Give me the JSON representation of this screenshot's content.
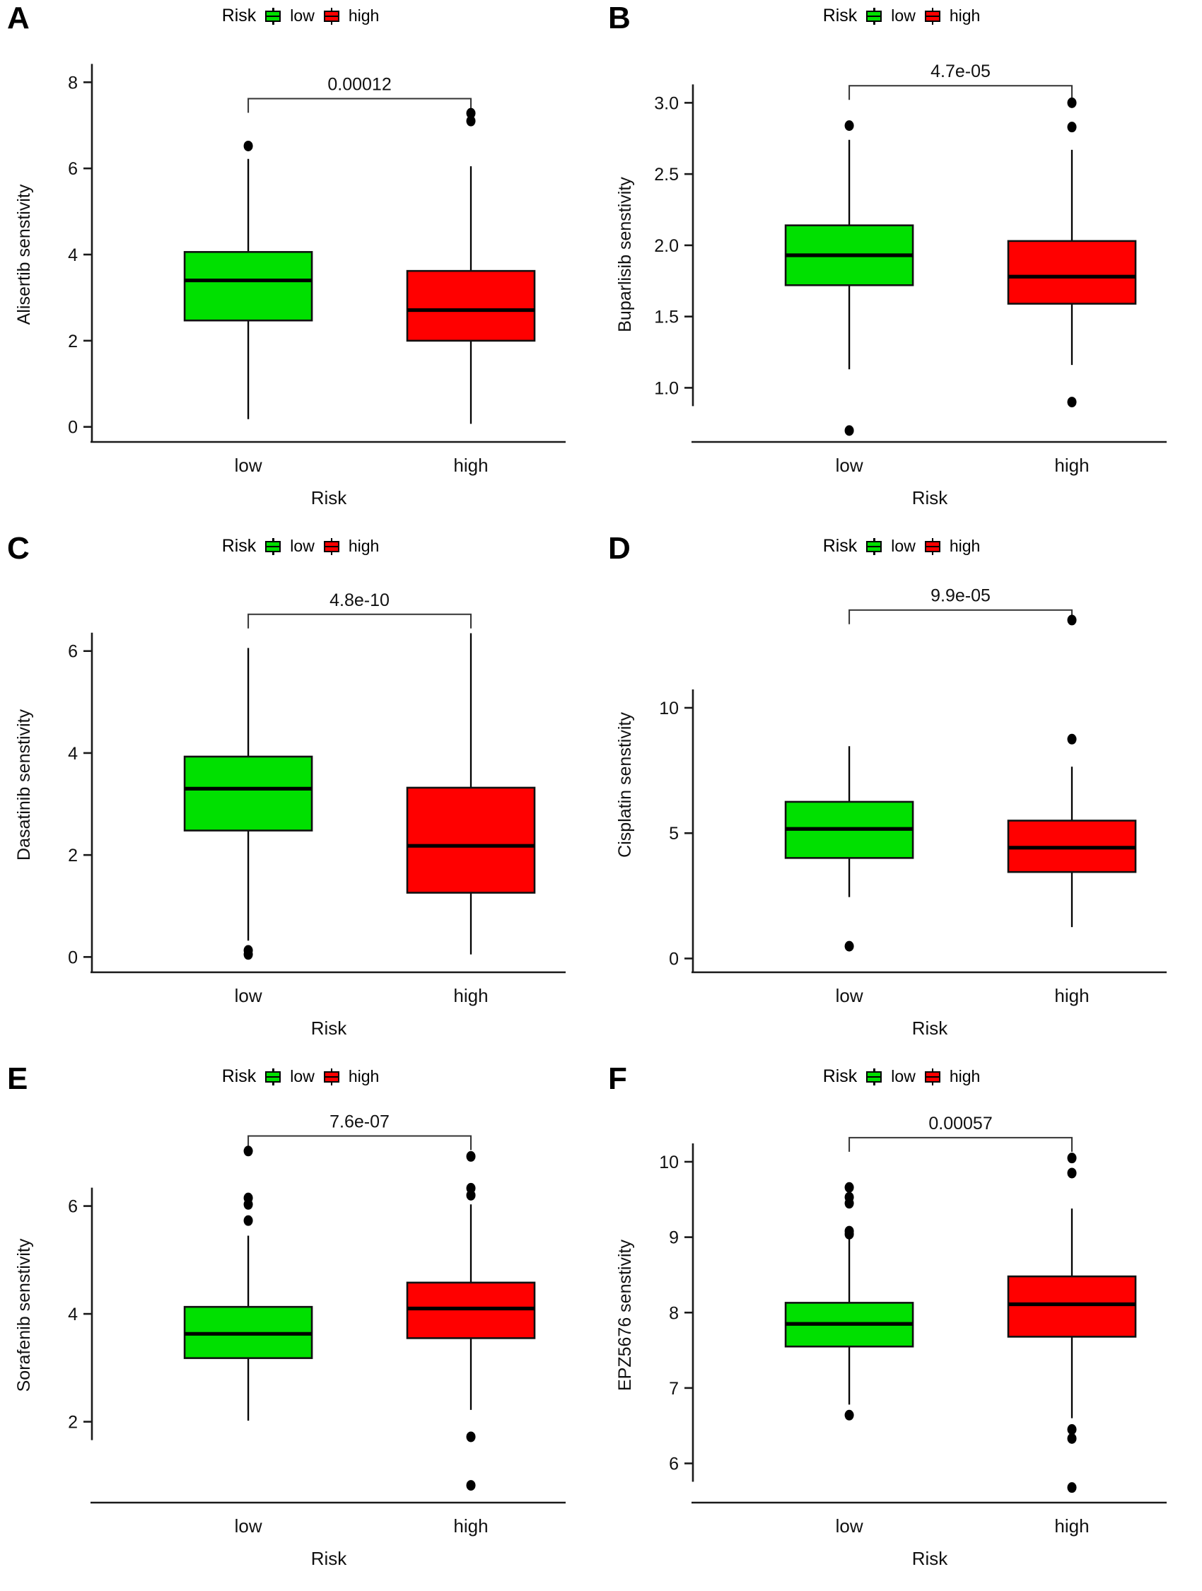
{
  "figure": {
    "legend": {
      "title": "Risk",
      "low_label": "low",
      "high_label": "high"
    },
    "colors": {
      "low": "#00E000",
      "high": "#FF0000",
      "outline": "#111111",
      "text": "#111111"
    },
    "x_axis_title": "Risk",
    "categories": [
      "low",
      "high"
    ]
  },
  "panels": [
    {
      "letter": "A",
      "ylabel": "Alisertib senstivity",
      "pvalue": "0.00012",
      "ylim": [
        -0.35,
        8.35
      ],
      "yticks": [
        0,
        2,
        4,
        6,
        8
      ],
      "ytick_labels": [
        "0",
        "2",
        "4",
        "6",
        "8"
      ],
      "bracket_y": 7.62,
      "chart_data": {
        "type": "box",
        "title": "",
        "xlabel": "Risk",
        "ylabel": "Alisertib senstivity",
        "categories": [
          "low",
          "high"
        ],
        "boxes": [
          {
            "group": "low",
            "color": "#00E000",
            "min": 0.18,
            "q1": 2.47,
            "median": 3.4,
            "q3": 4.06,
            "max": 6.22,
            "outliers": [
              6.52
            ]
          },
          {
            "group": "high",
            "color": "#FF0000",
            "min": 0.07,
            "q1": 2.0,
            "median": 2.71,
            "q3": 3.62,
            "max": 6.05,
            "outliers": [
              7.28,
              7.1
            ]
          }
        ],
        "annotations": [
          {
            "text": "0.00012",
            "type": "p-value",
            "between": [
              "low",
              "high"
            ]
          }
        ]
      }
    },
    {
      "letter": "B",
      "ylabel": "Buparlisib senstivity",
      "pvalue": "4.7e-05",
      "ylim": [
        0.62,
        3.25
      ],
      "yticks": [
        1.0,
        1.5,
        2.0,
        2.5,
        3.0
      ],
      "ytick_labels": [
        "1.0",
        "1.5",
        "2.0",
        "2.5",
        "3.0"
      ],
      "bracket_y": 3.12,
      "chart_data": {
        "type": "box",
        "title": "",
        "xlabel": "Risk",
        "ylabel": "Buparlisib senstivity",
        "categories": [
          "low",
          "high"
        ],
        "boxes": [
          {
            "group": "low",
            "color": "#00E000",
            "min": 1.13,
            "q1": 1.72,
            "median": 1.93,
            "q3": 2.14,
            "max": 2.74,
            "outliers": [
              2.84,
              0.7
            ]
          },
          {
            "group": "high",
            "color": "#FF0000",
            "min": 1.16,
            "q1": 1.59,
            "median": 1.78,
            "q3": 2.03,
            "max": 2.67,
            "outliers": [
              3.0,
              2.83,
              0.9
            ]
          }
        ],
        "annotations": [
          {
            "text": "4.7e-05",
            "type": "p-value",
            "between": [
              "low",
              "high"
            ]
          }
        ]
      }
    },
    {
      "letter": "C",
      "ylabel": "Dasatinib senstivity",
      "pvalue": "4.8e-10",
      "ylim": [
        -0.3,
        7.05
      ],
      "yticks": [
        0,
        2,
        4,
        6
      ],
      "ytick_labels": [
        "0",
        "2",
        "4",
        "6"
      ],
      "bracket_y": 6.72,
      "chart_data": {
        "type": "box",
        "title": "",
        "xlabel": "Risk",
        "ylabel": "Dasatinib senstivity",
        "categories": [
          "low",
          "high"
        ],
        "boxes": [
          {
            "group": "low",
            "color": "#00E000",
            "min": 0.32,
            "q1": 2.48,
            "median": 3.3,
            "q3": 3.93,
            "max": 6.06,
            "outliers": [
              0.13,
              0.05
            ]
          },
          {
            "group": "high",
            "color": "#FF0000",
            "min": 0.05,
            "q1": 1.26,
            "median": 2.18,
            "q3": 3.32,
            "max": 6.35,
            "outliers": []
          }
        ],
        "annotations": [
          {
            "text": "4.8e-10",
            "type": "p-value",
            "between": [
              "low",
              "high"
            ]
          }
        ]
      }
    },
    {
      "letter": "D",
      "ylabel": "Cisplatin senstivity",
      "pvalue": "9.9e-05",
      "ylim": [
        -0.55,
        14.4
      ],
      "yticks": [
        0,
        5,
        10
      ],
      "ytick_labels": [
        "0",
        "5",
        "10"
      ],
      "bracket_y": 13.9,
      "chart_data": {
        "type": "box",
        "title": "",
        "xlabel": "Risk",
        "ylabel": "Cisplatin senstivity",
        "categories": [
          "low",
          "high"
        ],
        "boxes": [
          {
            "group": "low",
            "color": "#00E000",
            "min": 2.45,
            "q1": 4.01,
            "median": 5.17,
            "q3": 6.25,
            "max": 8.47,
            "outliers": [
              0.49
            ]
          },
          {
            "group": "high",
            "color": "#FF0000",
            "min": 1.25,
            "q1": 3.45,
            "median": 4.42,
            "q3": 5.5,
            "max": 7.65,
            "outliers": [
              13.5,
              8.75
            ]
          }
        ],
        "annotations": [
          {
            "text": "9.9e-05",
            "type": "p-value",
            "between": [
              "low",
              "high"
            ]
          }
        ]
      }
    },
    {
      "letter": "E",
      "ylabel": "Sorafenib senstivity",
      "pvalue": "7.6e-07",
      "ylim": [
        0.5,
        7.45
      ],
      "yticks": [
        2,
        4,
        6
      ],
      "ytick_labels": [
        "2",
        "4",
        "6"
      ],
      "bracket_y": 7.3,
      "chart_data": {
        "type": "box",
        "title": "",
        "xlabel": "Risk",
        "ylabel": "Sorafenib senstivity",
        "categories": [
          "low",
          "high"
        ],
        "boxes": [
          {
            "group": "low",
            "color": "#00E000",
            "min": 2.02,
            "q1": 3.18,
            "median": 3.63,
            "q3": 4.13,
            "max": 5.45,
            "outliers": [
              7.02,
              6.15,
              6.03,
              5.73
            ]
          },
          {
            "group": "high",
            "color": "#FF0000",
            "min": 2.22,
            "q1": 3.55,
            "median": 4.1,
            "q3": 4.58,
            "max": 6.03,
            "outliers": [
              6.92,
              6.33,
              6.2,
              1.72,
              0.82
            ]
          }
        ],
        "annotations": [
          {
            "text": "7.6e-07",
            "type": "p-value",
            "between": [
              "low",
              "high"
            ]
          }
        ]
      }
    },
    {
      "letter": "F",
      "ylabel": "EPZ5676 senstivity",
      "pvalue": "0.00057",
      "ylim": [
        5.48,
        10.45
      ],
      "yticks": [
        6,
        7,
        8,
        9,
        10
      ],
      "ytick_labels": [
        "6",
        "7",
        "8",
        "9",
        "10"
      ],
      "bracket_y": 10.32,
      "chart_data": {
        "type": "box",
        "title": "",
        "xlabel": "Risk",
        "ylabel": "EPZ5676 senstivity",
        "categories": [
          "low",
          "high"
        ],
        "boxes": [
          {
            "group": "low",
            "color": "#00E000",
            "min": 6.78,
            "q1": 7.55,
            "median": 7.85,
            "q3": 8.13,
            "max": 9.02,
            "outliers": [
              9.66,
              9.53,
              9.45,
              9.08,
              9.04,
              6.64
            ]
          },
          {
            "group": "high",
            "color": "#FF0000",
            "min": 6.6,
            "q1": 7.68,
            "median": 8.11,
            "q3": 8.48,
            "max": 9.38,
            "outliers": [
              10.05,
              9.85,
              6.45,
              6.33,
              5.68
            ]
          }
        ],
        "annotations": [
          {
            "text": "0.00057",
            "type": "p-value",
            "between": [
              "low",
              "high"
            ]
          }
        ]
      }
    }
  ]
}
